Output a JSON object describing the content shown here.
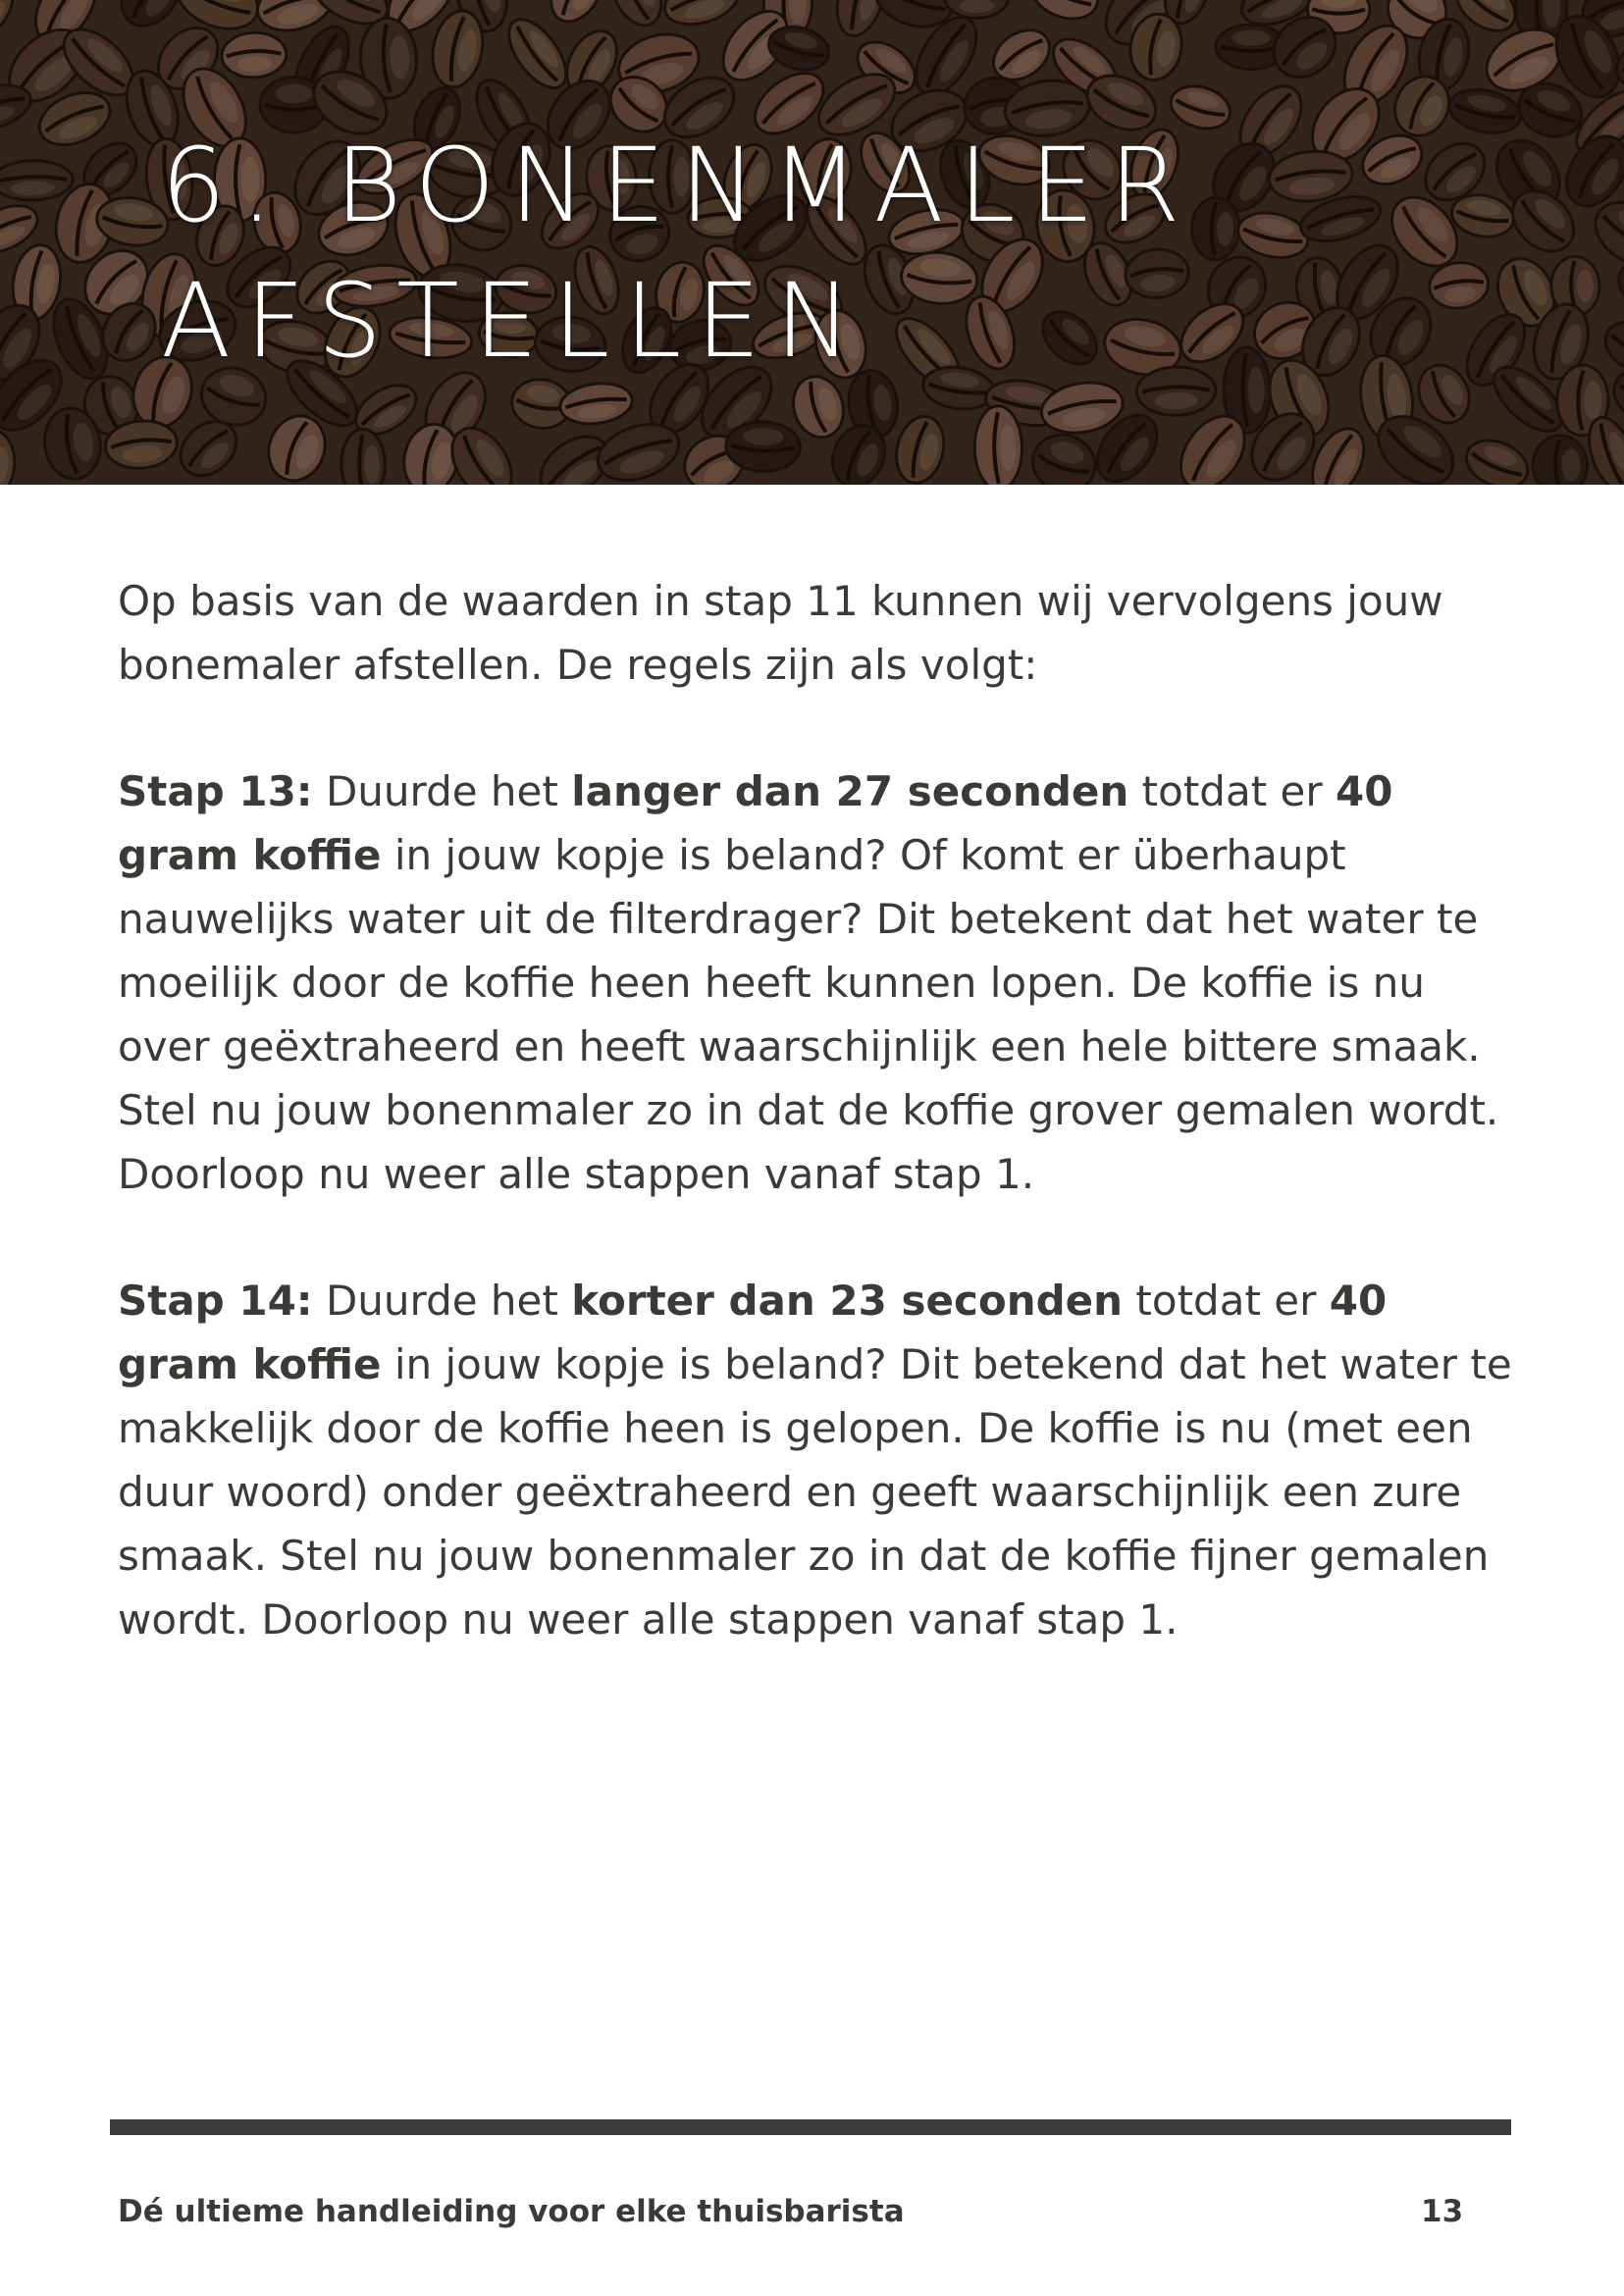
{
  "header": {
    "title_line1": "6. BONENMALER",
    "title_line2": "AFSTELLEN",
    "background": "coffee-beans-photo"
  },
  "body": {
    "intro": "Op basis van de waarden in stap 11 kunnen wij vervolgens jouw bonemaler afstellen. De regels zijn als volgt:",
    "step13": {
      "label": "Stap 13:",
      "t1": " Duurde het ",
      "b1": "langer dan 27 seconden",
      "t2": " totdat er ",
      "b2": "40 gram koffie",
      "t3": " in jouw kopje is beland? Of komt er überhaupt nauwelijks water uit de filterdrager? Dit betekent dat het water te moeilijk door de koffie heen heeft kunnen lopen. De koffie is nu over geëxtraheerd en heeft waarschijnlijk een hele bittere smaak. Stel nu jouw bonenmaler zo in dat de koffie grover gemalen wordt. Doorloop nu weer alle stappen vanaf stap 1."
    },
    "step14": {
      "label": "Stap 14:",
      "t1": " Duurde het ",
      "b1": "korter dan 23 seconden",
      "t2": " totdat er ",
      "b2": "40 gram koffie",
      "t3": " in jouw kopje is beland? Dit betekend dat het water te makkelijk door de koffie heen is gelopen. De koffie is nu (met een duur woord) onder geëxtraheerd en geeft waarschijnlijk een zure smaak. Stel nu jouw bonenmaler zo in dat de koffie fijner gemalen wordt. Doorloop nu weer alle stappen vanaf stap 1."
    }
  },
  "footer": {
    "title": "Dé ultieme handleiding voor elke thuisbarista",
    "page": "13"
  },
  "colors": {
    "text": "#3c3a37",
    "rule": "#3d3c3a",
    "header_bg": "#3a2a20"
  }
}
